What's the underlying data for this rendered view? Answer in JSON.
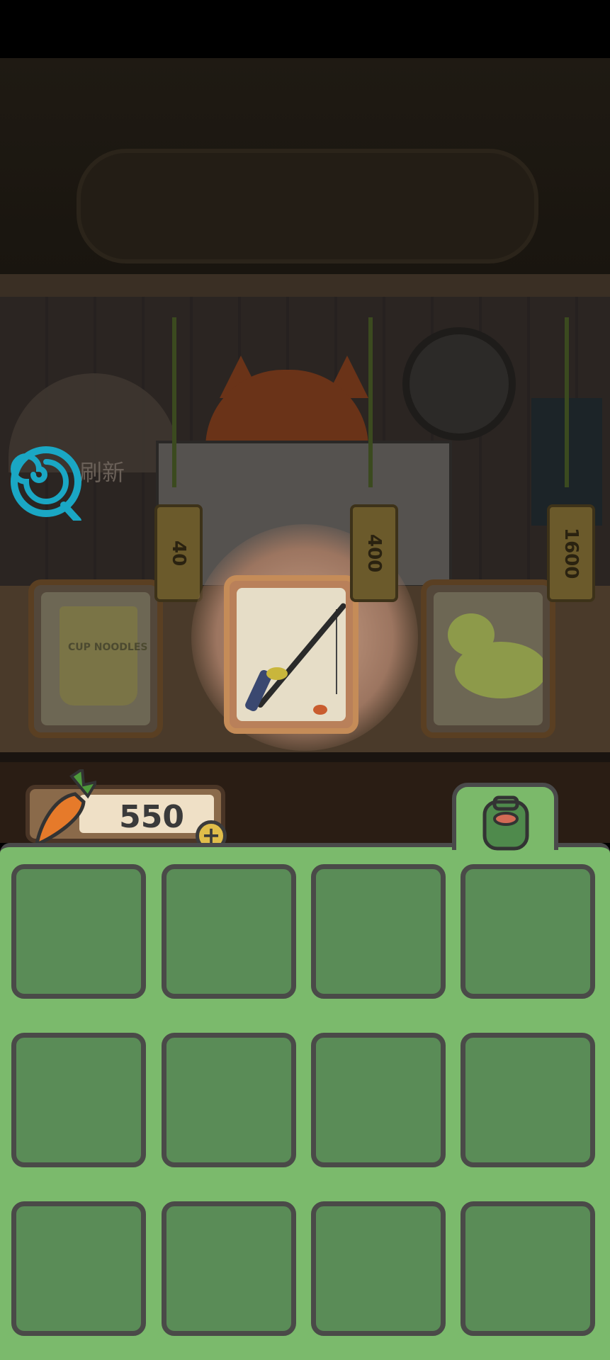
{
  "shop": {
    "refresh_label": "刷新",
    "items": [
      {
        "name": "cup-noodles",
        "price": "40",
        "label": "CUP NOODLES"
      },
      {
        "name": "fishing-rod",
        "price": "400",
        "selected": true
      },
      {
        "name": "rubber-duck",
        "price": "1600"
      }
    ]
  },
  "wallet": {
    "carrots": "550",
    "add_label": "+"
  },
  "inventory": {
    "tab_icon": "backpack-icon",
    "slots": 12
  },
  "colors": {
    "panel": "#7bba6c",
    "slot": "#5a8c57",
    "spiral": "#1aa7c4"
  }
}
